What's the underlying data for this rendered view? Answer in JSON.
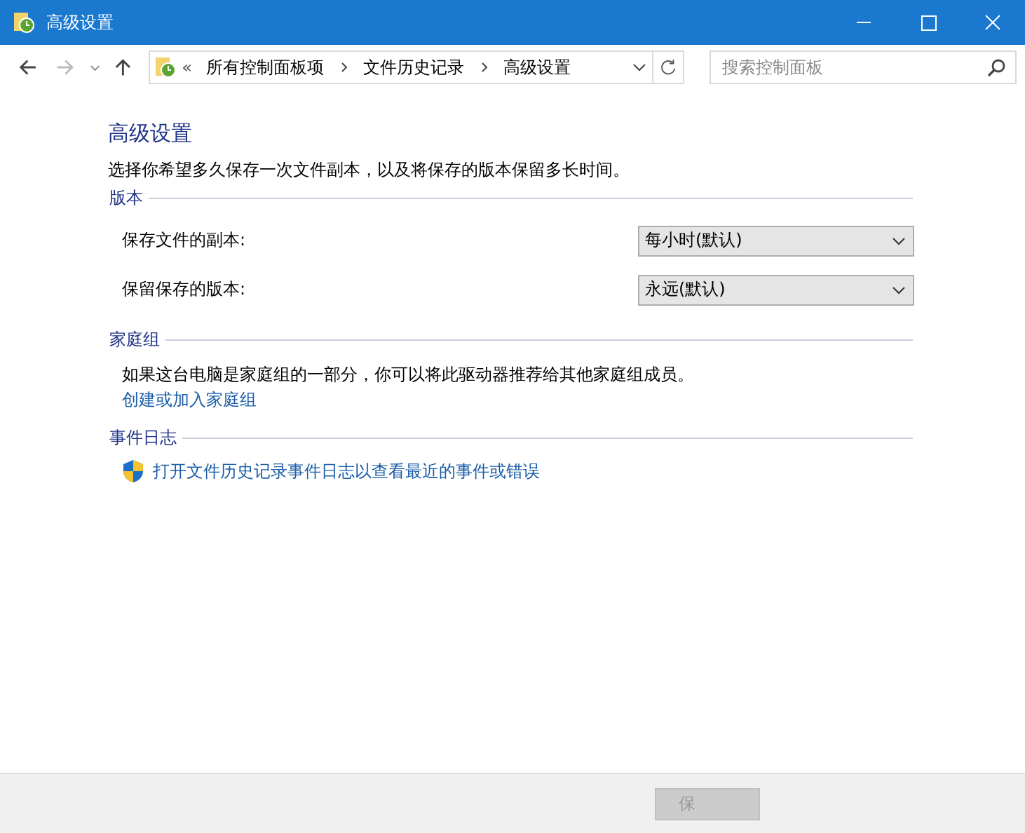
{
  "window": {
    "title": "高级设置"
  },
  "address_bar": {
    "overflow": "«",
    "crumbs": [
      "所有控制面板项",
      "文件历史记录",
      "高级设置"
    ]
  },
  "search": {
    "placeholder": "搜索控制面板"
  },
  "heading": "高级设置",
  "intro": "选择你希望多久保存一次文件副本，以及将保存的版本保留多长时间。",
  "sections": [
    {
      "title": "版本",
      "items": [
        {
          "kind": "dropdown",
          "label": "保存文件的副本:",
          "value": "每小时(默认)"
        },
        {
          "kind": "dropdown",
          "label": "保留保存的版本:",
          "value": "永远(默认)"
        }
      ]
    },
    {
      "title": "家庭组",
      "items": [
        {
          "kind": "text",
          "text": "如果这台电脑是家庭组的一部分，你可以将此驱动器推荐给其他家庭组成员。"
        },
        {
          "kind": "link",
          "text": "创建或加入家庭组"
        }
      ]
    },
    {
      "title": "事件日志",
      "items": [
        {
          "kind": "shield_link",
          "text": "打开文件历史记录事件日志以查看最近的事件或错误"
        }
      ]
    }
  ],
  "footer_buttons": [
    {
      "label": "保",
      "disabled": true
    }
  ]
}
